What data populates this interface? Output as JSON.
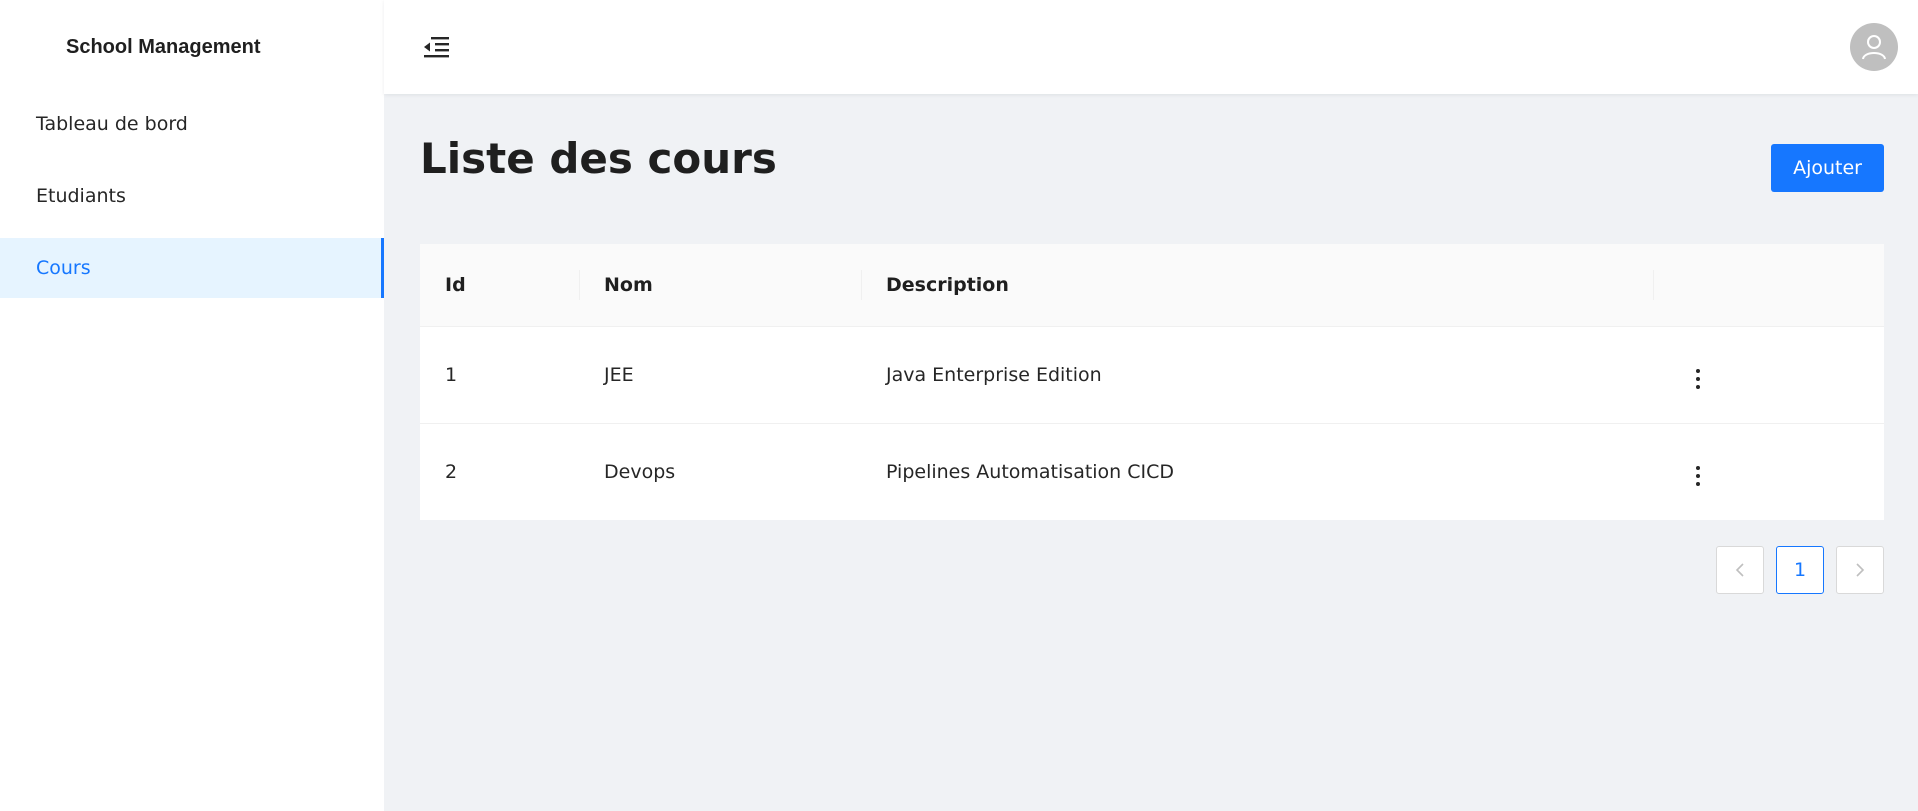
{
  "app": {
    "title": "School Management"
  },
  "sidebar": {
    "items": [
      {
        "label": "Tableau de bord",
        "active": false
      },
      {
        "label": "Etudiants",
        "active": false
      },
      {
        "label": "Cours",
        "active": true
      }
    ]
  },
  "topbar": {
    "menu_icon": "menu-fold-icon",
    "avatar_icon": "user-icon"
  },
  "page": {
    "title": "Liste des cours",
    "add_label": "Ajouter"
  },
  "table": {
    "columns": [
      "Id",
      "Nom",
      "Description",
      ""
    ],
    "rows": [
      {
        "id": "1",
        "nom": "JEE",
        "description": "Java Enterprise Edition"
      },
      {
        "id": "2",
        "nom": "Devops",
        "description": "Pipelines Automatisation CICD"
      }
    ]
  },
  "pagination": {
    "current": "1",
    "prev_icon": "chevron-left-icon",
    "next_icon": "chevron-right-icon"
  },
  "colors": {
    "accent": "#1677ff",
    "active_bg": "#e6f4ff",
    "page_bg": "#f0f2f5"
  }
}
